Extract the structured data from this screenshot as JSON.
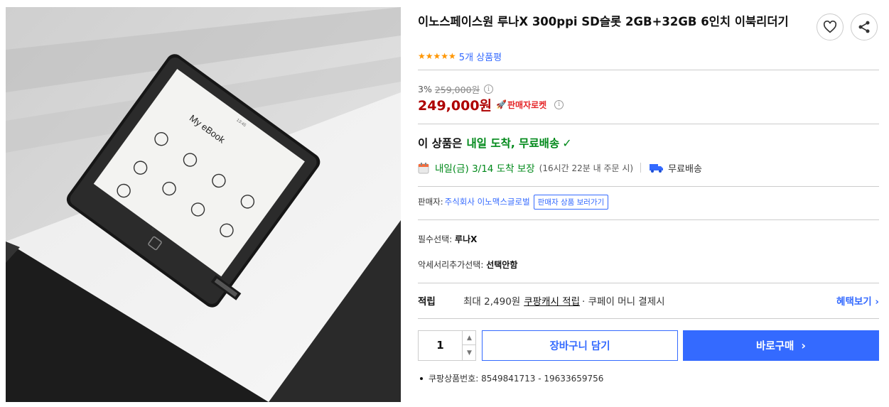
{
  "product": {
    "title": "이노스페이스원 루나X 300ppi SD슬롯 2GB+32GB 6인치 이북리더기",
    "rating_stars": "★★★★★",
    "review_count_text": "5개 상품평"
  },
  "device_screen": {
    "title": "My eBook",
    "status_time": "13:45"
  },
  "pricing": {
    "discount_rate": "3%",
    "original_price": "259,000원",
    "sale_price": "249,000원",
    "seller_badge": "판매자로켓"
  },
  "delivery": {
    "headline_prefix": "이 상품은",
    "headline_highlight": "내일 도착, 무료배송",
    "arrival_text": "내일(금) 3/14 도착 보장",
    "arrival_note": "(16시간 22분 내 주문 시)",
    "free_shipping": "무료배송"
  },
  "seller": {
    "label": "판매자:",
    "name": "주식회사 이노맥스글로벌",
    "view_products_button": "판매자 상품 보러가기"
  },
  "options": {
    "required_label": "필수선택:",
    "required_value": "루나X",
    "accessory_label": "악세서리추가선택:",
    "accessory_value": "선택안함"
  },
  "points": {
    "label": "적립",
    "text_prefix": "최대 2,490원",
    "link_text": "쿠팡캐시 적립",
    "text_suffix": "· 쿠페이 머니 결제시",
    "benefit_link": "혜택보기"
  },
  "purchase": {
    "quantity": "1",
    "cart_button": "장바구니 담기",
    "buy_button": "바로구매"
  },
  "product_id": {
    "label": "쿠팡상품번호: 8549841713 - 19633659756"
  },
  "colors": {
    "accent_blue": "#346aff",
    "price_red": "#ae0000",
    "delivery_green": "#00891a",
    "star_orange": "#ff9600"
  }
}
